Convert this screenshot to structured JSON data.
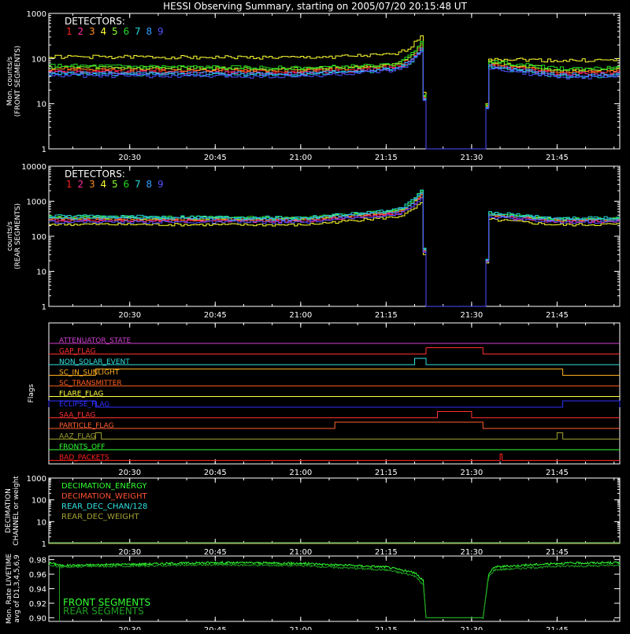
{
  "title": "HESSI Observing Summary, starting on 2005/07/20 20:15:48 UT",
  "detector_colors": [
    "#ff2020",
    "#ff2fa0",
    "#ff8c20",
    "#ffff30",
    "#8aff2f",
    "#22dd22",
    "#24d8d8",
    "#30a0ff",
    "#5050ff"
  ],
  "x_ticks": [
    "20:30",
    "20:45",
    "21:00",
    "21:15",
    "21:30",
    "21:45"
  ],
  "chart_data": [
    {
      "type": "line",
      "id": "front",
      "ylabel": "Mon. counts/s\n(FRONT SEGMENTS)",
      "yscale": "log",
      "ylim": [
        1,
        1000
      ],
      "y_ticks": [
        "1",
        "10",
        "100",
        "1000"
      ],
      "legend_title": "DETECTORS:",
      "legend_labels": [
        "1",
        "2",
        "3",
        "4",
        "5",
        "6",
        "7",
        "8",
        "9"
      ],
      "x": [
        "20:15:48",
        "21:00",
        "21:15",
        "21:21",
        "21:22",
        "21:32",
        "21:33",
        "21:45",
        "21:56"
      ],
      "series": [
        {
          "name": "1",
          "values": [
            55,
            52,
            65,
            180,
            1,
            1,
            75,
            48,
            50
          ]
        },
        {
          "name": "2",
          "values": [
            50,
            48,
            60,
            160,
            1,
            1,
            70,
            45,
            46
          ]
        },
        {
          "name": "3",
          "values": [
            60,
            55,
            68,
            200,
            1,
            1,
            80,
            52,
            55
          ]
        },
        {
          "name": "4",
          "values": [
            110,
            105,
            120,
            320,
            1,
            1,
            100,
            90,
            92
          ]
        },
        {
          "name": "5",
          "values": [
            65,
            60,
            70,
            220,
            1,
            1,
            85,
            58,
            58
          ]
        },
        {
          "name": "6",
          "values": [
            70,
            62,
            72,
            240,
            1,
            1,
            88,
            60,
            62
          ]
        },
        {
          "name": "7",
          "values": [
            45,
            44,
            55,
            150,
            1,
            1,
            65,
            40,
            42
          ]
        },
        {
          "name": "8",
          "values": [
            48,
            46,
            58,
            170,
            1,
            1,
            68,
            44,
            44
          ]
        },
        {
          "name": "9",
          "values": [
            42,
            40,
            52,
            140,
            1,
            1,
            60,
            38,
            40
          ]
        }
      ]
    },
    {
      "type": "line",
      "id": "rear",
      "ylabel": "counts/s\n(REAR SEGMENTS)",
      "yscale": "log",
      "ylim": [
        1,
        10000
      ],
      "y_ticks": [
        "1",
        "10",
        "100",
        "1000",
        "10000"
      ],
      "legend_title": "DETECTORS:",
      "legend_labels": [
        "1",
        "2",
        "3",
        "4",
        "5",
        "6",
        "7",
        "8",
        "9"
      ],
      "x": [
        "20:15:48",
        "21:00",
        "21:15",
        "21:21",
        "21:22",
        "21:32",
        "21:33",
        "21:45",
        "21:56"
      ],
      "series": [
        {
          "name": "1",
          "values": [
            300,
            290,
            450,
            1500,
            1,
            1,
            400,
            280,
            290
          ]
        },
        {
          "name": "2",
          "values": [
            280,
            270,
            420,
            1300,
            1,
            1,
            380,
            260,
            270
          ]
        },
        {
          "name": "3",
          "values": [
            320,
            300,
            470,
            1600,
            1,
            1,
            420,
            290,
            300
          ]
        },
        {
          "name": "4",
          "values": [
            220,
            210,
            340,
            900,
            1,
            1,
            300,
            210,
            220
          ]
        },
        {
          "name": "5",
          "values": [
            340,
            320,
            500,
            1800,
            1,
            1,
            440,
            300,
            310
          ]
        },
        {
          "name": "6",
          "values": [
            360,
            340,
            520,
            2000,
            1,
            1,
            460,
            310,
            320
          ]
        },
        {
          "name": "7",
          "values": [
            380,
            350,
            540,
            2100,
            1,
            1,
            480,
            330,
            340
          ]
        },
        {
          "name": "8",
          "values": [
            330,
            310,
            490,
            1700,
            1,
            1,
            430,
            300,
            300
          ]
        },
        {
          "name": "9",
          "values": [
            260,
            250,
            400,
            1200,
            1,
            1,
            350,
            250,
            260
          ]
        }
      ]
    },
    {
      "type": "line",
      "id": "flags",
      "ylabel": "Flags",
      "series": [
        {
          "name": "ATTENUATOR_STATE",
          "color": "#d040d0",
          "on": []
        },
        {
          "name": "GAP_FLAG",
          "color": "#ff3030",
          "on": [
            [
              "21:22",
              "21:32"
            ]
          ]
        },
        {
          "name": "NON_SOLAR_EVENT",
          "color": "#30e0e0",
          "on": [
            [
              "21:20",
              "21:22"
            ]
          ]
        },
        {
          "name": "SC_IN_SUNLIGHT",
          "color": "#ffb020",
          "on": [
            [
              "20:24",
              "21:46"
            ]
          ]
        },
        {
          "name": "SC_TRANSMITTER",
          "color": "#ff6020",
          "on": []
        },
        {
          "name": "FLARE_FLAG",
          "color": "#ffff40",
          "on": []
        },
        {
          "name": "ECLIPSE_FLAG",
          "color": "#3030ff",
          "on": [
            [
              "20:15:48",
              "20:24"
            ],
            [
              "21:46",
              "21:56"
            ]
          ]
        },
        {
          "name": "SAA_FLAG",
          "color": "#ff3030",
          "on": [
            [
              "21:24",
              "21:30"
            ]
          ]
        },
        {
          "name": "PARTICLE_FLAG",
          "color": "#ff6030",
          "on": [
            [
              "21:06",
              "21:32"
            ]
          ]
        },
        {
          "name": "AAZ_FLAG",
          "color": "#a0a030",
          "on": [
            [
              "20:24",
              "20:25"
            ],
            [
              "21:45",
              "21:46"
            ]
          ]
        },
        {
          "name": "FRONTS_OFF",
          "color": "#30ff30",
          "on": []
        },
        {
          "name": "BAD_PACKETS",
          "color": "#ff2020",
          "on": [
            [
              "21:35",
              "21:35:20"
            ]
          ]
        }
      ]
    },
    {
      "type": "line",
      "id": "decimation",
      "ylabel": "DECIMATION\nCHANNEL or weight",
      "yscale": "log",
      "ylim": [
        1,
        1000
      ],
      "y_ticks": [
        "1",
        "10",
        "100",
        "1000"
      ],
      "series": [
        {
          "name": "DECIMATION_ENERGY",
          "color": "#30ff30"
        },
        {
          "name": "DECIMATION_WEIGHT",
          "color": "#ff5030"
        },
        {
          "name": "REAR_DEC_CHAN/128",
          "color": "#30e0e0"
        },
        {
          "name": "REAR_DEC_WEIGHT",
          "color": "#a0a030"
        }
      ]
    },
    {
      "type": "line",
      "id": "livetime",
      "ylabel": "Mon. Rate LIVETIME\navg of D1,3,4,5,6,9",
      "ylim": [
        0.895,
        0.985
      ],
      "y_ticks": [
        "0.90",
        "0.92",
        "0.94",
        "0.96",
        "0.98"
      ],
      "x": [
        "20:15:48",
        "20:17",
        "20:18",
        "20:45",
        "21:00",
        "21:15",
        "21:20",
        "21:21:30",
        "21:22",
        "21:32",
        "21:33",
        "21:34",
        "21:45",
        "21:56"
      ],
      "series": [
        {
          "name": "FRONT SEGMENTS",
          "color": "#30ff30",
          "values": [
            0.976,
            0.974,
            0.972,
            0.976,
            0.975,
            0.97,
            0.962,
            0.952,
            0.9,
            0.9,
            0.96,
            0.97,
            0.975,
            0.976
          ]
        },
        {
          "name": "REAR SEGMENTS",
          "color": "#20a020",
          "values": [
            0.972,
            0.971,
            0.97,
            0.973,
            0.972,
            0.966,
            0.958,
            0.946,
            0.9,
            0.9,
            0.956,
            0.966,
            0.971,
            0.972
          ]
        }
      ]
    }
  ]
}
